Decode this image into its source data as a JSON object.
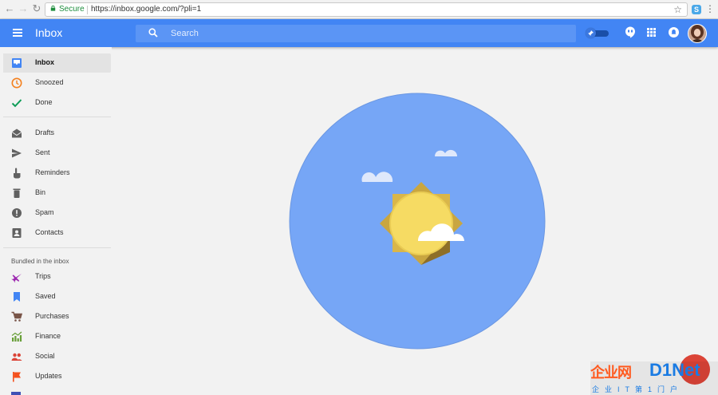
{
  "browser": {
    "secure_label": "Secure",
    "url": "https://inbox.google.com/?pli=1"
  },
  "appbar": {
    "title": "Inbox",
    "search_placeholder": "Search",
    "brand_color": "#4285f4"
  },
  "sidebar": {
    "primary": [
      {
        "label": "Inbox",
        "icon": "inbox-icon",
        "active": true
      },
      {
        "label": "Snoozed",
        "icon": "clock-icon"
      },
      {
        "label": "Done",
        "icon": "check-icon"
      }
    ],
    "secondary": [
      {
        "label": "Drafts",
        "icon": "drafts-icon"
      },
      {
        "label": "Sent",
        "icon": "send-icon"
      },
      {
        "label": "Reminders",
        "icon": "reminder-hand-icon"
      },
      {
        "label": "Bin",
        "icon": "trash-icon"
      },
      {
        "label": "Spam",
        "icon": "spam-icon"
      },
      {
        "label": "Contacts",
        "icon": "contacts-icon"
      }
    ],
    "bundles_heading": "Bundled in the inbox",
    "bundles": [
      {
        "label": "Trips",
        "icon": "plane-icon",
        "color": "#9c27b0"
      },
      {
        "label": "Saved",
        "icon": "bookmark-icon",
        "color": "#4285f4"
      },
      {
        "label": "Purchases",
        "icon": "cart-icon",
        "color": "#795548"
      },
      {
        "label": "Finance",
        "icon": "finance-chart-icon",
        "color": "#689f38"
      },
      {
        "label": "Social",
        "icon": "people-icon",
        "color": "#db4437"
      },
      {
        "label": "Updates",
        "icon": "flag-icon",
        "color": "#f4511e"
      }
    ]
  },
  "watermark": {
    "chinese": "企业网",
    "brand": "D1Net",
    "subtitle": "企业IT第1门户"
  }
}
